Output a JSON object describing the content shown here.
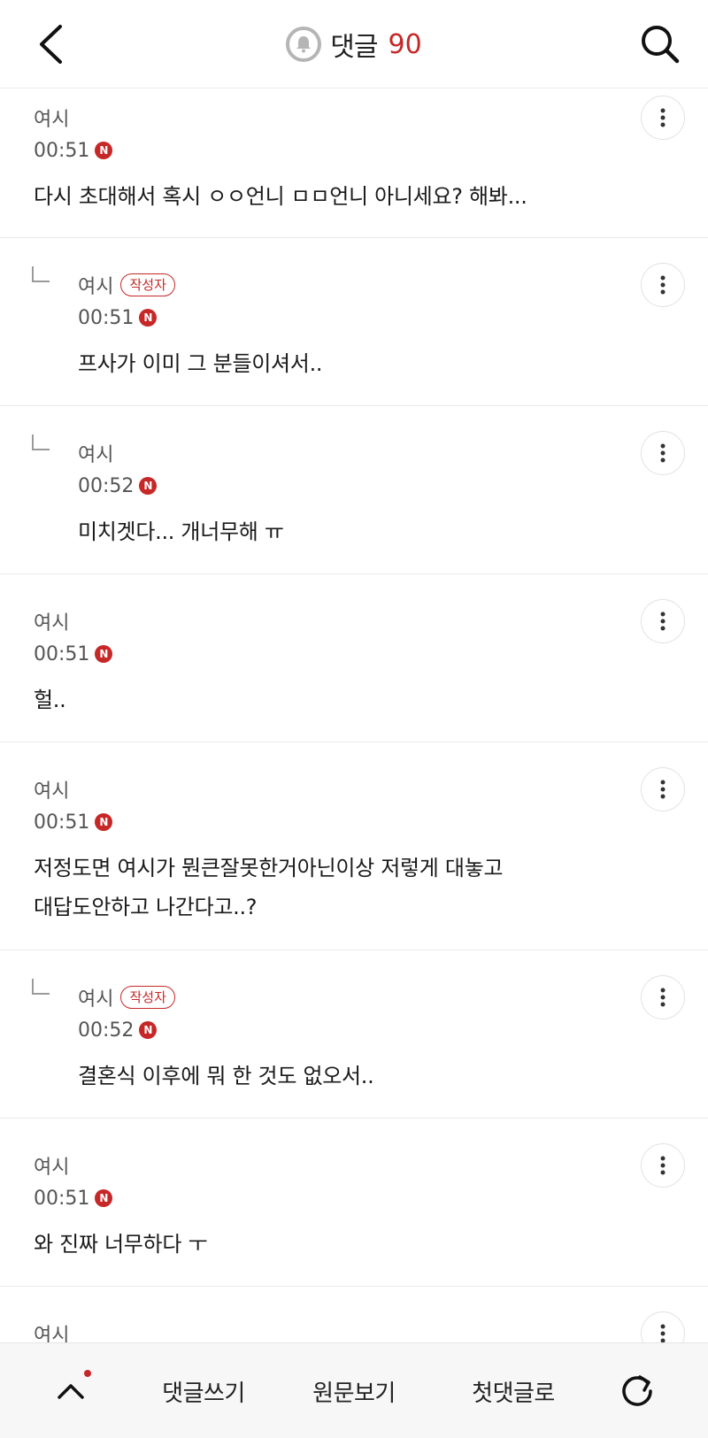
{
  "header": {
    "title": "댓글",
    "count": "90"
  },
  "comments": [
    {
      "author": "여시",
      "badge": "",
      "time": "00:51",
      "new_label": "N",
      "text": "다시 초대해서 혹시 ㅇㅇ언니 ㅁㅁ언니 아니세요? 해봐..."
    },
    {
      "author": "여시",
      "badge": "작성자",
      "time": "00:51",
      "new_label": "N",
      "text": "프사가 이미 그 분들이셔서.."
    },
    {
      "author": "여시",
      "badge": "",
      "time": "00:52",
      "new_label": "N",
      "text": "미치겟다... 개너무해 ㅠ"
    },
    {
      "author": "여시",
      "badge": "",
      "time": "00:51",
      "new_label": "N",
      "text": "헐.."
    },
    {
      "author": "여시",
      "badge": "",
      "time": "00:51",
      "new_label": "N",
      "text_line1": "저정도면 여시가 뭔큰잘못한거아닌이상 저렇게 대놓고",
      "text_line2": "대답도안하고 나간다고..?"
    },
    {
      "author": "여시",
      "badge": "작성자",
      "time": "00:52",
      "new_label": "N",
      "text": "결혼식 이후에 뭐 한 것도 없오서.."
    },
    {
      "author": "여시",
      "badge": "",
      "time": "00:51",
      "new_label": "N",
      "text": "와 진짜 너무하다 ㅜ"
    },
    {
      "author": "여시"
    }
  ],
  "bottom_bar": {
    "write": "댓글쓰기",
    "original": "원문보기",
    "first": "첫댓글로"
  },
  "colors": {
    "accent": "#c62828",
    "text": "#1a1a1a",
    "muted": "#555555"
  },
  "icons": {
    "back": "chevron-left-icon",
    "bell": "bell-icon",
    "search": "search-icon",
    "more": "more-vertical-icon",
    "up": "chevron-up-icon",
    "refresh": "refresh-icon"
  }
}
